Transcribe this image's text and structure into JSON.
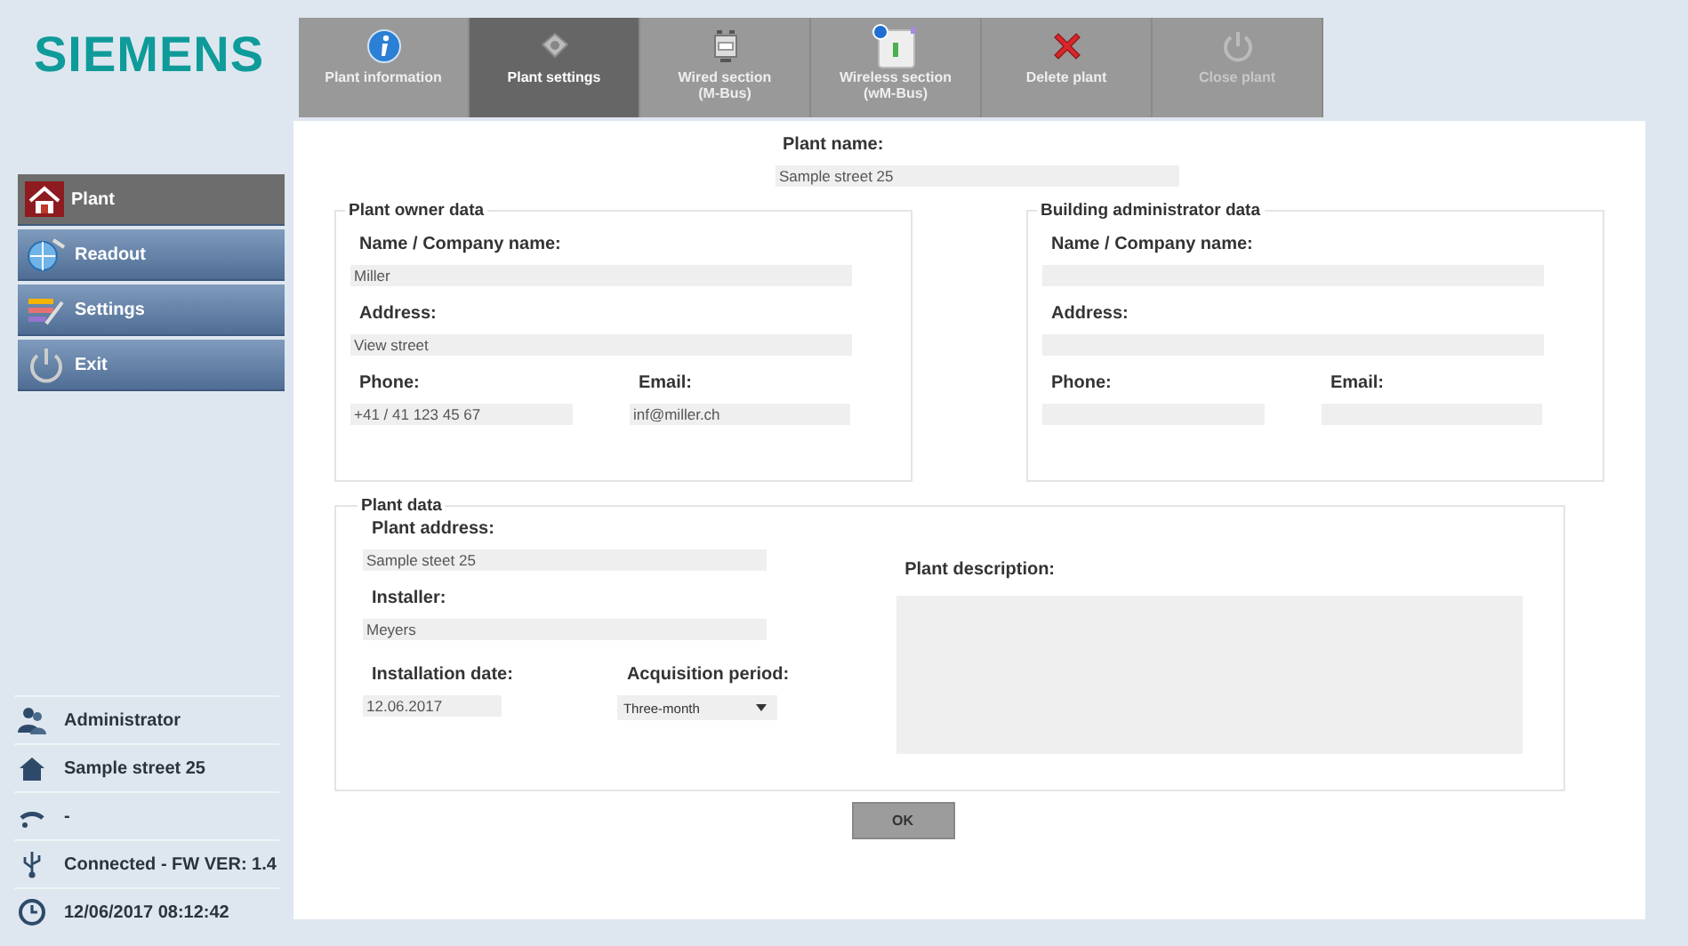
{
  "logo": "SIEMENS",
  "toolbar": [
    {
      "label": "Plant information",
      "selected": false,
      "disabled": false
    },
    {
      "label": "Plant settings",
      "selected": true,
      "disabled": false
    },
    {
      "label": "Wired section",
      "sublabel": "(M-Bus)",
      "selected": false,
      "disabled": false
    },
    {
      "label": "Wireless section",
      "sublabel": "(wM-Bus)",
      "selected": false,
      "disabled": false
    },
    {
      "label": "Delete plant",
      "selected": false,
      "disabled": false
    },
    {
      "label": "Close plant",
      "selected": false,
      "disabled": true
    }
  ],
  "sidebar": {
    "items": [
      {
        "label": "Plant",
        "selected": true
      },
      {
        "label": "Readout",
        "selected": false
      },
      {
        "label": "Settings",
        "selected": false
      },
      {
        "label": "Exit",
        "selected": false
      }
    ]
  },
  "plant_name": {
    "label": "Plant name:",
    "value": "Sample street 25"
  },
  "owner": {
    "title": "Plant owner data",
    "name": {
      "label": "Name / Company name:",
      "value": "Miller"
    },
    "address": {
      "label": "Address:",
      "value": "View street"
    },
    "phone": {
      "label": "Phone:",
      "value": "+41 / 41 123 45 67"
    },
    "email": {
      "label": "Email:",
      "value": "inf@miller.ch"
    }
  },
  "administrator": {
    "title": "Building administrator data",
    "name": {
      "label": "Name / Company name:"
    },
    "address": {
      "label": "Address:"
    },
    "phone": {
      "label": "Phone:"
    },
    "email": {
      "label": "Email:"
    }
  },
  "plant_data": {
    "title": "Plant data",
    "address": {
      "label": "Plant address:",
      "value": "Sample steet 25"
    },
    "installer": {
      "label": "Installer:",
      "value": "Meyers"
    },
    "installation_date": {
      "label": "Installation date:",
      "value": "12.06.2017"
    },
    "acquisition_period": {
      "label": "Acquisition period:",
      "value": "Three-month"
    },
    "description": {
      "label": "Plant description:"
    }
  },
  "ok_button": "OK",
  "status": [
    {
      "text": "Administrator"
    },
    {
      "text": "Sample street 25"
    },
    {
      "text": "-"
    },
    {
      "text": "Connected - FW VER: 1.4"
    },
    {
      "text": "12/06/2017 08:12:42"
    }
  ]
}
